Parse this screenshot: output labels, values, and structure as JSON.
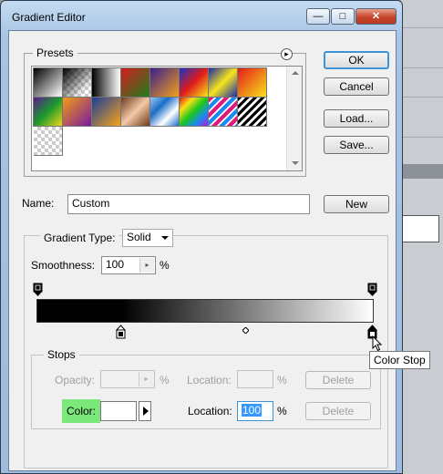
{
  "window": {
    "title": "Gradient Editor",
    "minimize_glyph": "—",
    "maximize_glyph": "□",
    "close_glyph": "✕"
  },
  "presets": {
    "label": "Presets",
    "menu_glyph": "▸",
    "swatches": [
      "linear-gradient(135deg,#000,#fff)",
      "checker-black",
      "linear-gradient(90deg,#000,#fff)",
      "linear-gradient(135deg,#d21d1d,#1f7d1f)",
      "linear-gradient(135deg,#3b1e8c,#f2a01a)",
      "linear-gradient(135deg,#1734c8,#e21a1a,#f8e81a)",
      "linear-gradient(135deg,#1a2aa8,#f6e51c,#1a2aa8)",
      "linear-gradient(135deg,#e31a1a,#f8e21a)",
      "linear-gradient(135deg,#5a1a8f,#1b9a2d,#f0d41a)",
      "linear-gradient(135deg,#f39b13,#7a1a9f)",
      "linear-gradient(135deg,#1a3d9a,#f6a31a)",
      "linear-gradient(135deg,#6d3a1a,#f3c8a8,#6d3a1a)",
      "linear-gradient(135deg,#9ac8ef,#1a6dc8,#fff,#1a6dc8)",
      "linear-gradient(135deg,#e01a1a,#f8e01a,#1ac81a,#1a8af0,#b01ae0)",
      "stripes-rainbow",
      "stripes-bw",
      "checker-gray"
    ]
  },
  "buttons": {
    "ok": "OK",
    "cancel": "Cancel",
    "load": "Load...",
    "save": "Save...",
    "new": "New"
  },
  "name": {
    "label": "Name:",
    "value": "Custom"
  },
  "gradient_type": {
    "label": "Gradient Type:",
    "value": "Solid"
  },
  "smoothness": {
    "label": "Smoothness:",
    "value": "100",
    "unit": "%"
  },
  "gradient_bar": {
    "from_color": "#000000",
    "to_color": "#ffffff",
    "midpoint_fraction": 0.62,
    "color_stop_fraction": 0.25
  },
  "stops": {
    "label": "Stops",
    "opacity_label": "Opacity:",
    "opacity_unit": "%",
    "location_label": "Location:",
    "location_unit": "%",
    "delete_label": "Delete",
    "color_label": "Color:",
    "color_value": "#ffffff",
    "color_location_label": "Location:",
    "color_location_value": "100",
    "color_location_unit": "%",
    "color_delete_label": "Delete"
  },
  "tooltip": "Color Stop",
  "colors": {
    "color_label_bg": "#7ce87c",
    "accent": "#3d95d8"
  }
}
